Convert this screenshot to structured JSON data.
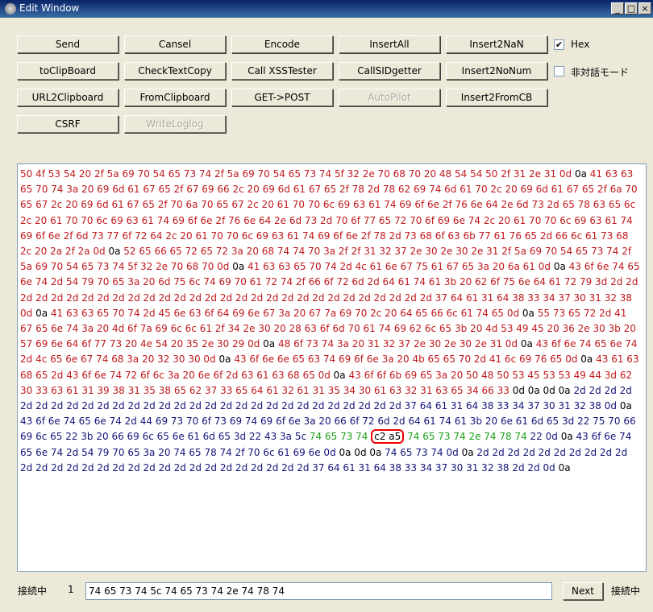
{
  "window": {
    "title": "Edit Window"
  },
  "buttons": {
    "row1": [
      "Send",
      "Cansel",
      "Encode",
      "InsertAll",
      "Insert2NaN"
    ],
    "row2": [
      "toClipBoard",
      "CheckTextCopy",
      "Call XSSTester",
      "CallSIDgetter",
      "Insert2NoNum"
    ],
    "row3": [
      "URL2Clipboard",
      "FromClipboard",
      "GET->POST",
      "AutoPilot",
      "Insert2FromCB"
    ],
    "row4": [
      "CSRF",
      "WriteLoglog"
    ]
  },
  "checkboxes": {
    "hex_label": "Hex",
    "hex_checked": true,
    "non_dialog_label": "非対話モード",
    "non_dialog_checked": false
  },
  "hex_segments": [
    {
      "color": "red",
      "text": "50 4f 53 54 20 2f 5a 69 70 54 65 73 74 2f 5a 69 70 54 65 73 74 5f 32 2e 70 68 70 20 48 54 54 50 2f 31 2e 31 0d "
    },
    {
      "color": "black",
      "text": "0a "
    },
    {
      "color": "red",
      "text": "41 63 63 65 70 74 3a 20 69 6d 61 67 65 2f 67 69 66 2c 20 69 6d 61 67 65 2f 78 2d 78 62 69 74 6d 61 70 2c 20 69 6d 61 67 65 2f 6a 70 65 67 2c 20 69 6d 61 67 65 2f 70 6a 70 65 67 2c 20 61 70 70 6c 69 63 61 74 69 6f 6e 2f 76 6e 64 2e 6d 73 2d 65 78 63 65 6c 2c 20 61 70 70 6c 69 63 61 74 69 6f 6e 2f 76 6e 64 2e 6d 73 2d 70 6f 77 65 72 70 6f 69 6e 74 2c 20 61 70 70 6c 69 63 61 74 69 6f 6e 2f 6d 73 77 6f 72 64 2c 20 61 70 70 6c 69 63 61 74 69 6f 6e 2f 78 2d 73 68 6f 63 6b 77 61 76 65 2d 66 6c 61 73 68 2c 20 2a 2f 2a 0d "
    },
    {
      "color": "black",
      "text": "0a "
    },
    {
      "color": "red",
      "text": "52 65 66 65 72 65 72 3a 20 68 74 74 70 3a 2f 2f 31 32 37 2e 30 2e 30 2e 31 2f 5a 69 70 54 65 73 74 2f 5a 69 70 54 65 73 74 5f 32 2e 70 68 70 0d "
    },
    {
      "color": "black",
      "text": "0a "
    },
    {
      "color": "red",
      "text": "41 63 63 65 70 74 2d 4c 61 6e 67 75 61 67 65 3a 20 6a 61 0d "
    },
    {
      "color": "black",
      "text": "0a "
    },
    {
      "color": "red",
      "text": "43 6f 6e 74 65 6e 74 2d 54 79 70 65 3a 20 6d 75 6c 74 69 70 61 72 74 2f 66 6f 72 6d 2d 64 61 74 61 3b 20 62 6f 75 6e 64 61 72 79 3d 2d 2d 2d 2d 2d 2d 2d 2d 2d 2d 2d 2d 2d 2d 2d 2d 2d 2d 2d 2d 2d 2d 2d 2d 2d 2d 2d 2d 2d 37 64 61 31 64 38 33 34 37 30 31 32 38 0d "
    },
    {
      "color": "black",
      "text": "0a "
    },
    {
      "color": "red",
      "text": "41 63 63 65 70 74 2d 45 6e 63 6f 64 69 6e 67 3a 20 67 7a 69 70 2c 20 64 65 66 6c 61 74 65 0d "
    },
    {
      "color": "black",
      "text": "0a "
    },
    {
      "color": "red",
      "text": "55 73 65 72 2d 41 67 65 6e 74 3a 20 4d 6f 7a 69 6c 6c 61 2f 34 2e 30 20 28 63 6f 6d 70 61 74 69 62 6c 65 3b 20 4d 53 49 45 20 36 2e 30 3b 20 57 69 6e 64 6f 77 73 20 4e 54 20 35 2e 30 29 0d "
    },
    {
      "color": "black",
      "text": "0a "
    },
    {
      "color": "red",
      "text": "48 6f 73 74 3a 20 31 32 37 2e 30 2e 30 2e 31 0d "
    },
    {
      "color": "black",
      "text": "0a "
    },
    {
      "color": "red",
      "text": "43 6f 6e 74 65 6e 74 2d 4c 65 6e 67 74 68 3a 20 32 30 30 0d "
    },
    {
      "color": "black",
      "text": "0a "
    },
    {
      "color": "red",
      "text": "43 6f 6e 6e 65 63 74 69 6f 6e 3a 20 4b 65 65 70 2d 41 6c 69 76 65 0d "
    },
    {
      "color": "black",
      "text": "0a "
    },
    {
      "color": "red",
      "text": "43 61 63 68 65 2d 43 6f 6e 74 72 6f 6c 3a 20 6e 6f 2d 63 61 63 68 65 0d "
    },
    {
      "color": "black",
      "text": "0a "
    },
    {
      "color": "red",
      "text": "43 6f 6f 6b 69 65 3a 20 50 48 50 53 45 53 53 49 44 3d 62 30 33 63 61 31 39 38 31 35 38 65 62 37 33 65 64 61 32 61 31 35 34 30 61 63 32 31 63 65 34 66 33 "
    },
    {
      "color": "black",
      "text": "0d 0a 0d 0a "
    },
    {
      "color": "blue",
      "text": "2d 2d 2d 2d 2d 2d 2d 2d 2d 2d 2d 2d 2d 2d 2d 2d 2d 2d 2d 2d 2d 2d 2d 2d 2d 2d 2d 2d 2d 37 64 61 31 64 38 33 34 37 30 31 32 38 0d "
    },
    {
      "color": "black",
      "text": "0a "
    },
    {
      "color": "blue",
      "text": "43 6f 6e 74 65 6e 74 2d 44 69 73 70 6f 73 69 74 69 6f 6e 3a 20 66 6f 72 6d 2d 64 61 74 61 3b 20 6e 61 6d 65 3d 22 75 70 66 69 6c 65 22 3b 20 66 69 6c 65 6e 61 6d 65 3d 22 43 3a 5c "
    },
    {
      "color": "green",
      "text": "74 65 73 74 "
    },
    {
      "color": "circled",
      "text": "c2 a5"
    },
    {
      "color": "green",
      "text": " 74 65 73 74 2e 74 78 74 "
    },
    {
      "color": "blue",
      "text": "22 0d "
    },
    {
      "color": "black",
      "text": "0a "
    },
    {
      "color": "blue",
      "text": "43 6f 6e 74 65 6e 74 2d 54 79 70 65 3a 20 74 65 78 74 2f 70 6c 61 69 6e 0d "
    },
    {
      "color": "black",
      "text": "0a 0d 0a "
    },
    {
      "color": "blue",
      "text": "74 65 73 74 0d "
    },
    {
      "color": "black",
      "text": "0a "
    },
    {
      "color": "blue",
      "text": "2d 2d 2d 2d 2d 2d 2d 2d 2d 2d 2d 2d 2d 2d 2d 2d 2d 2d 2d 2d 2d 2d 2d 2d 2d 2d 2d 2d 2d 37 64 61 31 64 38 33 34 37 30 31 32 38 2d 2d 0d "
    },
    {
      "color": "black",
      "text": "0a"
    }
  ],
  "status": {
    "left_label": "接続中",
    "count": "1",
    "input_value": "74 65 73 74 5c 74 65 73 74 2e 74 78 74",
    "next_label": "Next",
    "right_label": "接続中"
  }
}
